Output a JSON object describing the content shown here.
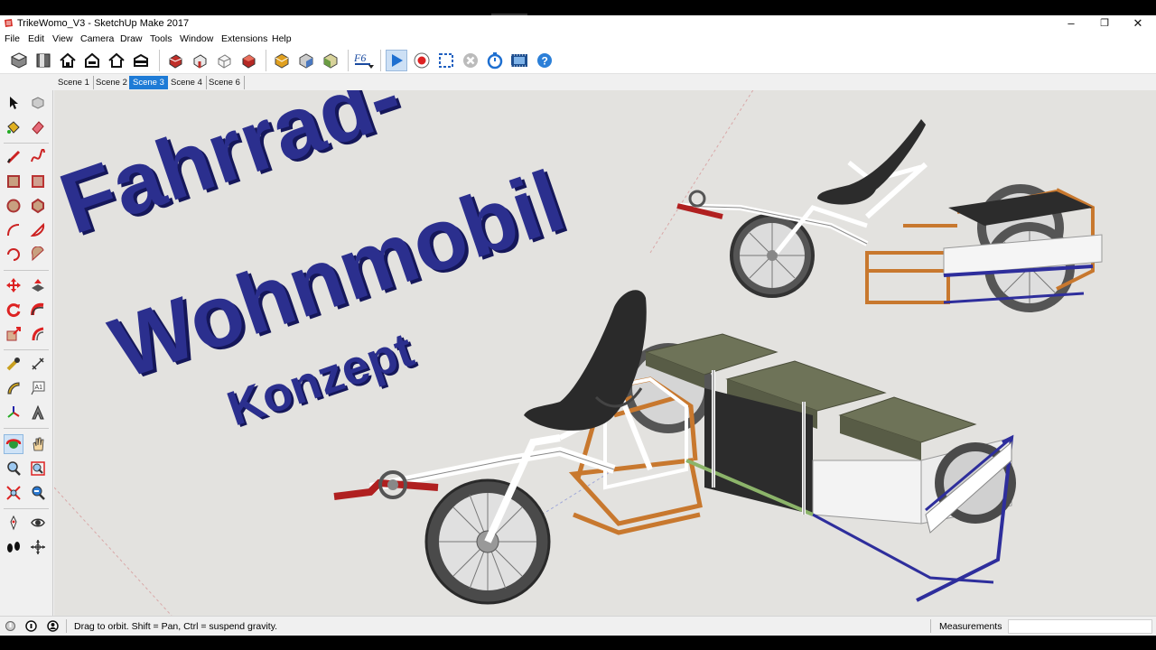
{
  "window": {
    "title": "TrikeWomo_V3 - SketchUp Make 2017",
    "controls": {
      "minimize": "–",
      "restore": "❐",
      "close": "✕"
    }
  },
  "menu": [
    "File",
    "Edit",
    "View",
    "Camera",
    "Draw",
    "Tools",
    "Window",
    "Extensions",
    "Help"
  ],
  "toolbar": {
    "icons": [
      "iso-view-icon",
      "top-view-icon",
      "front-view-icon",
      "right-view-icon",
      "back-view-icon",
      "left-view-icon",
      "xray-style-icon",
      "wireframe-style-icon",
      "hidden-line-style-icon",
      "shaded-style-icon",
      "section-plane-icon",
      "section-display-icon",
      "section-cut-icon",
      "f6-extension-icon",
      "play-animation-icon",
      "record-icon",
      "selection-box-icon",
      "stop-icon",
      "timer-icon",
      "film-icon",
      "help-icon"
    ],
    "f6_label": "F6"
  },
  "scenes": {
    "tabs": [
      "Scene 1",
      "Scene 2",
      "Scene 3",
      "Scene 4",
      "Scene 6"
    ],
    "active_index": 2
  },
  "tools": [
    "select",
    "component",
    "paint-bucket",
    "eraser",
    "line",
    "freehand",
    "rectangle",
    "rotated-rectangle",
    "circle",
    "polygon",
    "arc",
    "pie",
    "arc-3pt",
    "arc-2pt",
    "move",
    "push-pull",
    "rotate",
    "follow-me",
    "scale",
    "offset",
    "tape-measure",
    "dimension",
    "protractor",
    "text",
    "axes",
    "3d-text",
    "orbit",
    "pan",
    "zoom",
    "zoom-window",
    "zoom-extents",
    "previous",
    "position-camera",
    "look-around",
    "walk",
    "section-plane"
  ],
  "viewport": {
    "headline_line1": "Fahrrad-",
    "headline_line2": "Wohnmobil",
    "headline_line3": "Konzept",
    "text_color": "#2b2f8e"
  },
  "status": {
    "hint": "Drag to orbit. Shift = Pan, Ctrl = suspend gravity.",
    "measurements_label": "Measurements",
    "measurements_value": ""
  },
  "colors": {
    "frame_orange": "#c8782e",
    "cushion_green": "#6e7358",
    "rack_blue": "#2e2e9c",
    "crank_red": "#b02020",
    "accent_blue": "#1e7bd6"
  }
}
